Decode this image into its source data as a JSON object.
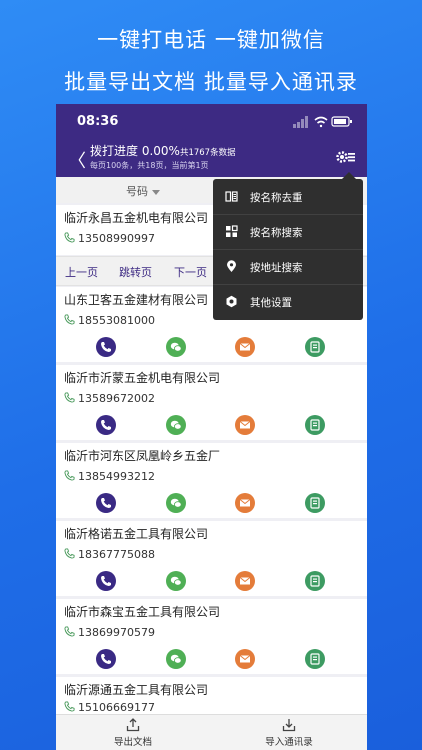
{
  "hero": {
    "line1": "一键打电话  一键加微信",
    "line2": "批量导出文档  批量导入通讯录"
  },
  "status_bar": {
    "time": "08:36"
  },
  "header": {
    "back_label": "〈",
    "progress_label": "拨打进度 0.00%",
    "total_label": "共1767条数据",
    "page_info": "每页100条，共18页，当前第1页"
  },
  "sort_bar": {
    "column_label": "号码"
  },
  "menu": {
    "items": [
      {
        "label": "按名称去重",
        "icon": "dedupe-icon"
      },
      {
        "label": "按名称搜索",
        "icon": "search-name-icon"
      },
      {
        "label": "按地址搜索",
        "icon": "location-icon"
      },
      {
        "label": "其他设置",
        "icon": "settings-hex-icon"
      }
    ]
  },
  "pager": {
    "prev": "上一页",
    "jump": "跳转页",
    "next": "下一页"
  },
  "contacts": [
    {
      "name": "临沂永昌五金机电有限公司",
      "phone": "13508990997"
    },
    {
      "name": "山东卫客五金建材有限公司",
      "phone": "18553081000"
    },
    {
      "name": "临沂市沂蒙五金机电有限公司",
      "phone": "13589672002"
    },
    {
      "name": "临沂市河东区凤凰岭乡五金厂",
      "phone": "13854993212"
    },
    {
      "name": "临沂格诺五金工具有限公司",
      "phone": "18367775088"
    },
    {
      "name": "临沂市森宝五金工具有限公司",
      "phone": "13869970579"
    },
    {
      "name": "临沂源通五金工具有限公司",
      "phone": "15106669177"
    }
  ],
  "bottom_bar": {
    "export_label": "导出文档",
    "import_label": "导入通讯录"
  },
  "colors": {
    "primary": "#3d2a83",
    "background": "#1f6ee8",
    "wechat": "#4faf55",
    "sms": "#e47c3a",
    "contact": "#3d9b62"
  }
}
